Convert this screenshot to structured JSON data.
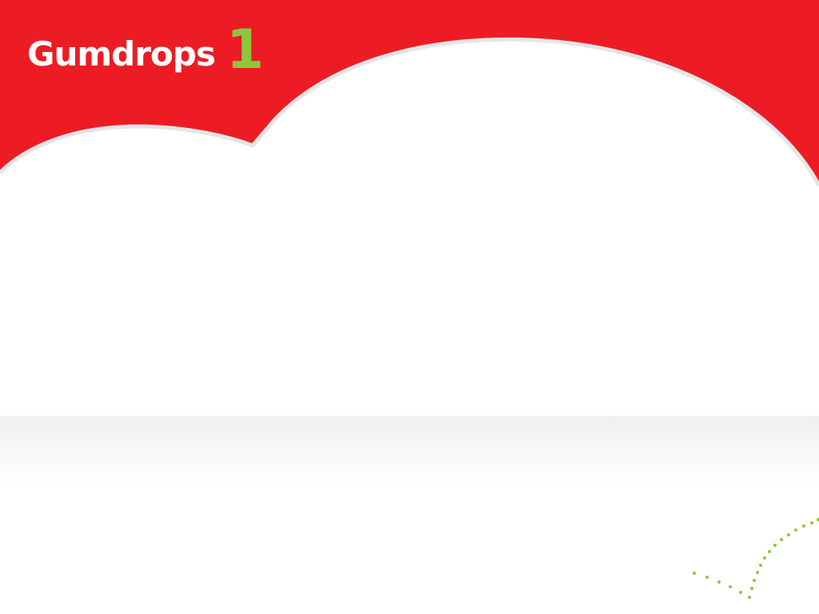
{
  "logo": {
    "word": "Gumdrops",
    "number": "1"
  },
  "colors": {
    "header": "#ed1c24",
    "logo_text": "#ffffff",
    "logo_number": "#8dc63f",
    "dots": "#8dc63f",
    "background": "#ffffff"
  },
  "decorations": {
    "dotted_path_icon": "dotted-arc-icon"
  }
}
